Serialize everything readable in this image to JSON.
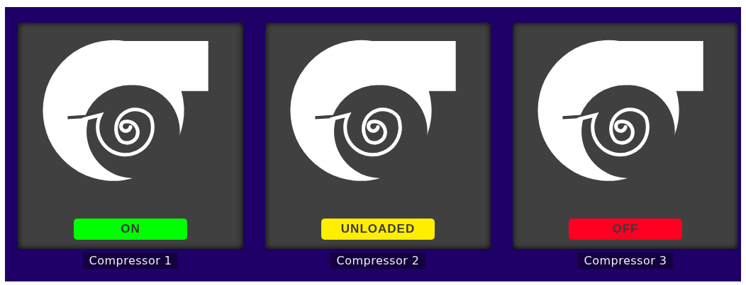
{
  "compressors": [
    {
      "status": "ON",
      "color": "#00ff00",
      "name": "Compressor 1"
    },
    {
      "status": "UNLOADED",
      "color": "#ffee00",
      "name": "Compressor 2"
    },
    {
      "status": "OFF",
      "color": "#ff0022",
      "name": "Compressor 3"
    }
  ]
}
